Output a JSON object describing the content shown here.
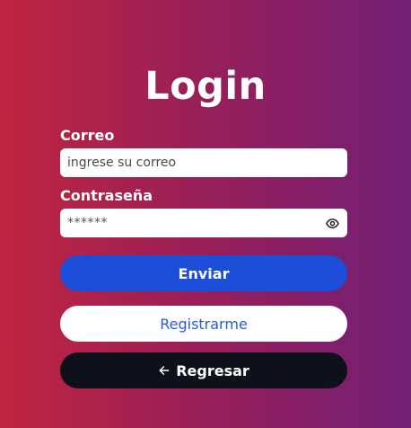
{
  "title": "Login",
  "email": {
    "label": "Correo",
    "placeholder": "ingrese su correo",
    "value": ""
  },
  "password": {
    "label": "Contraseña",
    "value": "******",
    "toggle_icon": "eye-icon"
  },
  "buttons": {
    "send": "Enviar",
    "register": "Registrarme",
    "back": "Regresar",
    "back_icon": "arrow-left-icon"
  },
  "colors": {
    "gradient_start": "#c0253f",
    "gradient_end": "#721f76",
    "send_button": "#1d4ed8",
    "register_text": "#2b5bd7",
    "back_button": "#0f111a"
  }
}
